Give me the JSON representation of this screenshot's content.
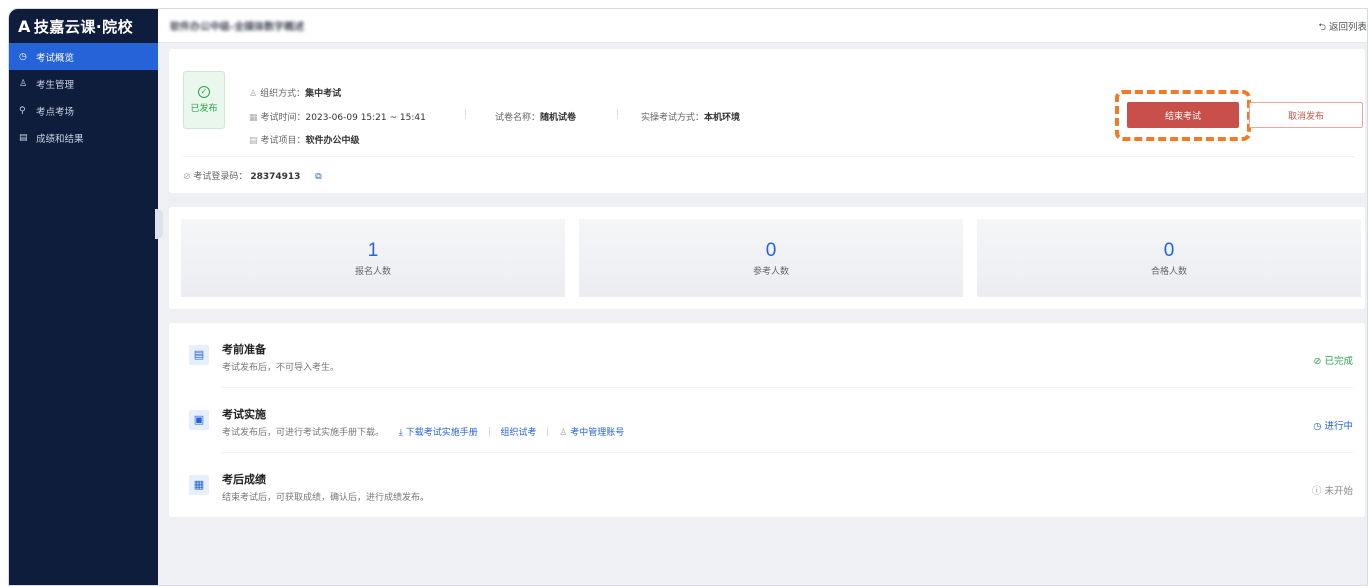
{
  "brand": {
    "logo_mark": "A",
    "title": "技嘉云课·院校"
  },
  "sidebar": {
    "items": [
      {
        "icon": "clock-icon",
        "glyph": "◷",
        "label": "考试概览",
        "active": true
      },
      {
        "icon": "user-icon",
        "glyph": "♙",
        "label": "考生管理",
        "active": false
      },
      {
        "icon": "location-pin-icon",
        "glyph": "⚲",
        "label": "考点考场",
        "active": false
      },
      {
        "icon": "document-icon",
        "glyph": "▤",
        "label": "成绩和结果",
        "active": false
      }
    ]
  },
  "header": {
    "title": "软件办公中级-全媒体数字概述",
    "back_label": "⮌ 返回列表"
  },
  "exam": {
    "status": "已发布",
    "org_label": "组织方式：",
    "org_value": "集中考试",
    "time_label": "考试时间：",
    "time_value": "2023-06-09 15:21 ~ 15:41",
    "paper_label": "试卷名称：",
    "paper_value": "随机试卷",
    "practice_label": "实操考试方式：",
    "practice_value": "本机环境",
    "project_label": "考试项目：",
    "project_value": "软件办公中级",
    "login_code_label": "考试登录码：",
    "login_code_value": "28374913",
    "end_button": "结束考试",
    "cancel_button": "取消发布",
    "highlight_color": "#f07a28"
  },
  "stats": [
    {
      "value": "1",
      "label": "报名人数"
    },
    {
      "value": "0",
      "label": "参考人数"
    },
    {
      "value": "0",
      "label": "合格人数"
    }
  ],
  "steps": [
    {
      "title": "考前准备",
      "desc": "考试发布后，不可导入考生。",
      "status": "⊘ 已完成"
    },
    {
      "title": "考试实施",
      "desc": "考试发布后，可进行考试实施手册下载。",
      "link_download": "⤓ 下载考试实施手册",
      "link_org": "组织试考",
      "link_admin": "考中管理账号",
      "status": "◷ 进行中"
    },
    {
      "title": "考后成绩",
      "desc": "结束考试后，可获取成绩，确认后，进行成绩发布。",
      "status": "ⓘ 未开始"
    }
  ],
  "colors": {
    "primary": "#2563d8",
    "sidebar_bg": "#0f1d3d",
    "danger": "#c9504a",
    "success": "#2fa24e"
  }
}
